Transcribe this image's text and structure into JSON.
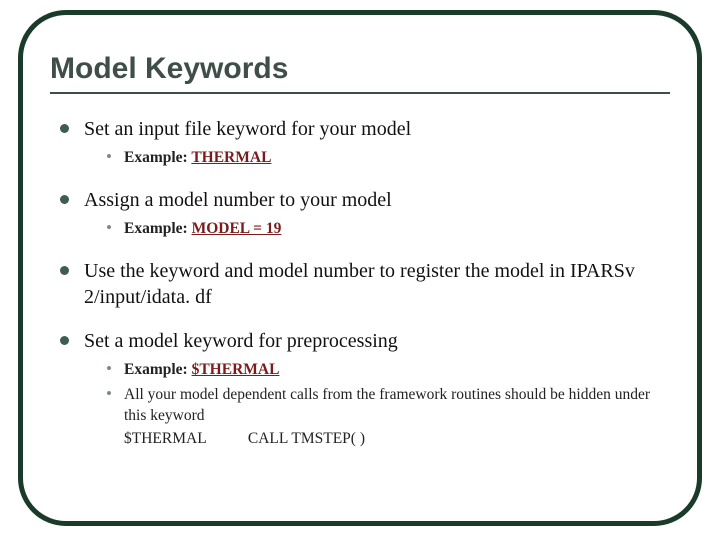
{
  "title": "Model Keywords",
  "items": [
    {
      "text": "Set an input file keyword for your model",
      "sub": [
        {
          "label": "Example: ",
          "keyword": "THERMAL"
        }
      ]
    },
    {
      "text": "Assign a model number to your model",
      "sub": [
        {
          "label": "Example: ",
          "keyword": "MODEL = 19"
        }
      ]
    },
    {
      "text": "Use the keyword and model number to register the model in IPARSv 2/input/idata. df"
    },
    {
      "text": "Set a model keyword for preprocessing",
      "sub": [
        {
          "label": "Example: ",
          "keyword": "$THERMAL"
        },
        {
          "note": "All your model dependent calls from the framework routines should be hidden under this keyword",
          "code1": "$THERMAL",
          "code2": "CALL TMSTEP( )"
        }
      ]
    }
  ]
}
